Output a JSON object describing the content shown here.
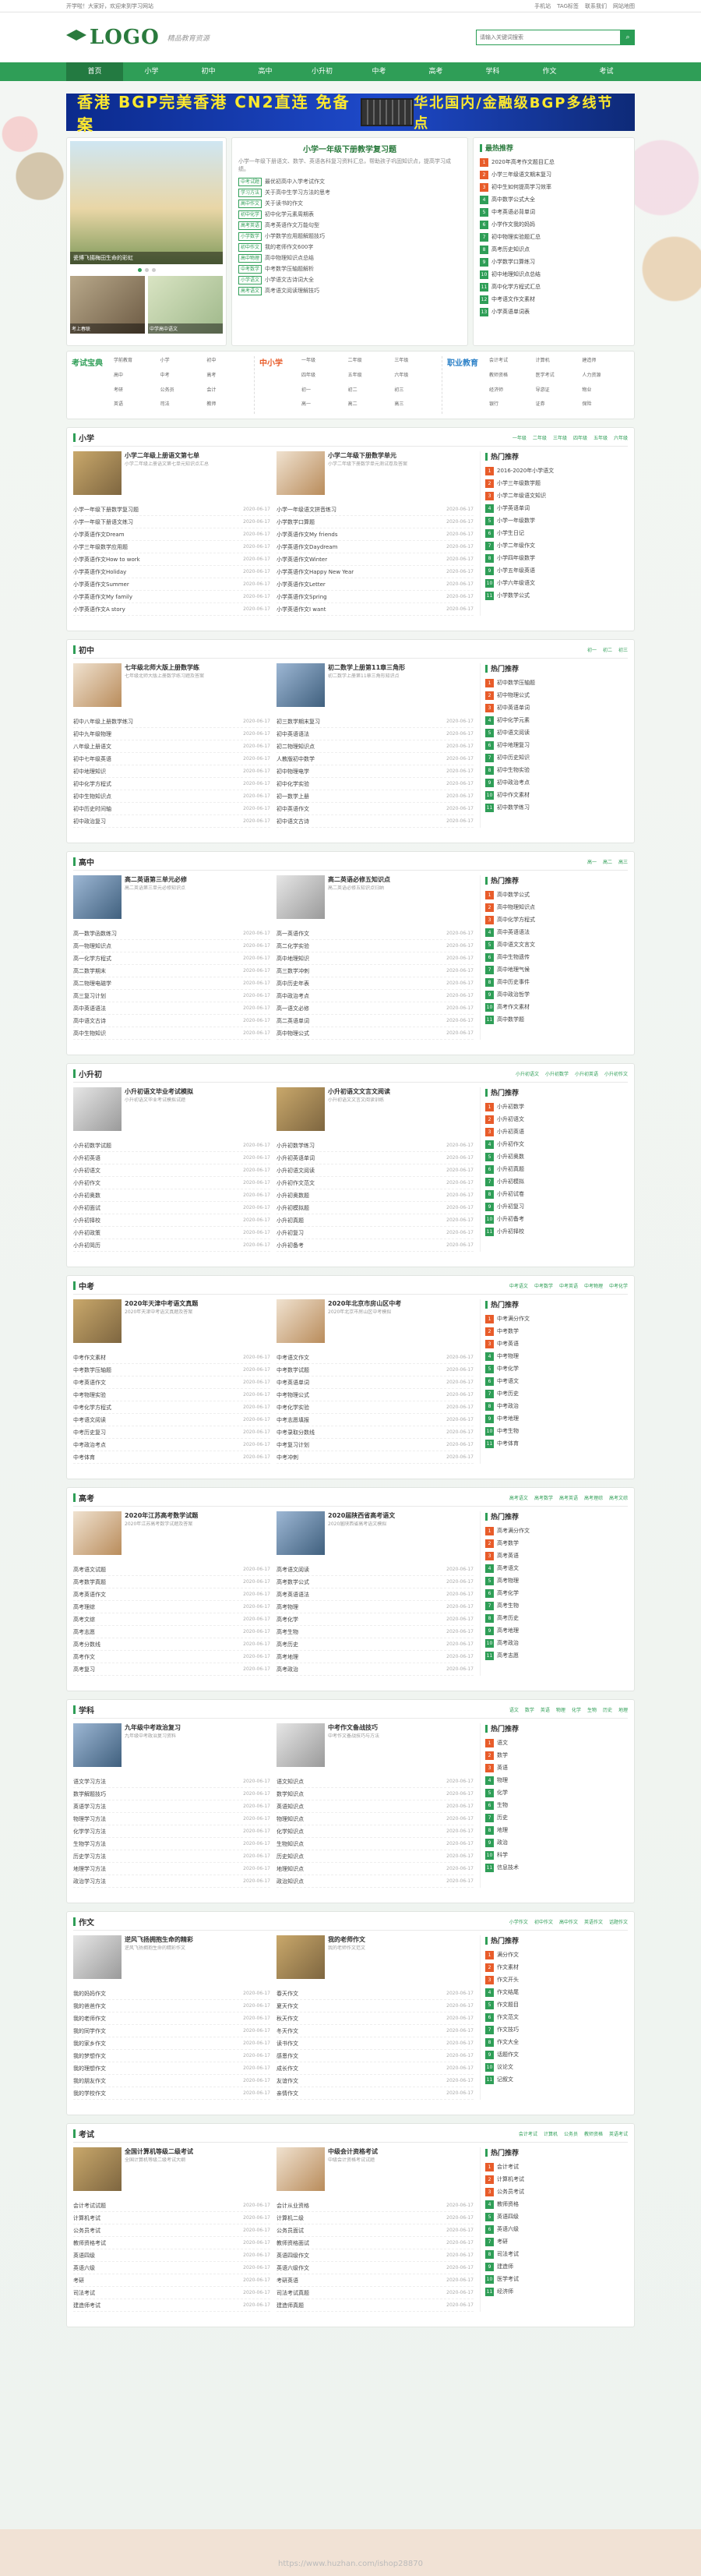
{
  "topbar": {
    "left": "开学啦！大家好，欢迎来到学习网站",
    "links": [
      "手机站",
      "TAG标签",
      "联系我们",
      "网站地图"
    ]
  },
  "header": {
    "logo": "LOGO",
    "slogan": "精品教育资源",
    "search_placeholder": "请输入关键词搜索",
    "search_icon": "search-icon"
  },
  "nav": [
    "首页",
    "小学",
    "初中",
    "高中",
    "小升初",
    "中考",
    "高考",
    "学科",
    "作文",
    "考试"
  ],
  "banner": {
    "left": "香港 BGP完美香港 CN2直连 免备案",
    "right": "华北国内/金融级BGP多线节点"
  },
  "hero": {
    "slide_caption": "瓷博飞揚梅田生命的彩虹",
    "thumbs": [
      "考上春联",
      "中学高中语文"
    ],
    "center_title": "小学一年级下册教学复习题",
    "center_desc": "小学一年级下册语文、数学、英语各科复习资料汇总，帮助孩子巩固知识点，提高学习成绩。",
    "items": [
      {
        "tag": "中考试题",
        "text": "最优初高中入学考试作文"
      },
      {
        "tag": "学习方法",
        "text": "关于高中生学习方法的思考"
      },
      {
        "tag": "高中作文",
        "text": "关于读书的作文"
      },
      {
        "tag": "初中化学",
        "text": "初中化学元素周期表"
      },
      {
        "tag": "高考英语",
        "text": "高考英语作文万能句型"
      },
      {
        "tag": "小学数学",
        "text": "小学数学应用题解题技巧"
      },
      {
        "tag": "初中作文",
        "text": "我的老师作文600字"
      },
      {
        "tag": "高中物理",
        "text": "高中物理知识点总结"
      },
      {
        "tag": "中考数学",
        "text": "中考数学压轴题解析"
      },
      {
        "tag": "小学语文",
        "text": "小学语文古诗词大全"
      },
      {
        "tag": "高考语文",
        "text": "高考语文阅读理解技巧"
      }
    ],
    "latest_title": "最热推荐",
    "latest": [
      "2020年高考作文题目汇总",
      "小学三年级语文期末复习",
      "初中生如何提高学习效率",
      "高中数学公式大全",
      "中考英语必背单词",
      "小学作文我的妈妈",
      "初中物理实验题汇总",
      "高考历史知识点",
      "小学数学口算练习",
      "初中地理知识点总结",
      "高中化学方程式汇总",
      "中考语文作文素材",
      "小学英语单词表"
    ]
  },
  "cats": [
    {
      "name": "考试宝典",
      "items": [
        "学前教育",
        "小学",
        "初中",
        "高中",
        "中考",
        "高考",
        "考研",
        "公务员",
        "会计",
        "英语",
        "司法",
        "教师"
      ]
    },
    {
      "name": "中小学",
      "items": [
        "一年级",
        "二年级",
        "三年级",
        "四年级",
        "五年级",
        "六年级",
        "初一",
        "初二",
        "初三",
        "高一",
        "高二",
        "高三"
      ]
    },
    {
      "name": "职业教育",
      "items": [
        "会计考试",
        "计算机",
        "建造师",
        "教师资格",
        "医学考试",
        "人力资源",
        "经济师",
        "导游证",
        "物业",
        "银行",
        "证券",
        "保险"
      ]
    }
  ],
  "panels": [
    {
      "title": "小学",
      "sub": [
        "一年级",
        "二年级",
        "三年级",
        "四年级",
        "五年级",
        "六年级"
      ],
      "feat": [
        {
          "h": "小学二年级上册语文第七单",
          "p": "小学二年级上册语文第七单元知识点汇总"
        },
        {
          "h": "小学二年级下册数学单元",
          "p": "小学二年级下册数学单元测试卷及答案"
        }
      ],
      "l1": [
        "小学一年级下册数学复习题",
        "小学一年级下册语文练习",
        "小学英语作文Dream",
        "小学三年级数学应用题",
        "小学英语作文How to work",
        "小学英语作文Holiday",
        "小学英语作文Summer",
        "小学英语作文My family",
        "小学英语作文A story"
      ],
      "l2": [
        "小学一年级语文拼音练习",
        "小学数学口算题",
        "小学英语作文My friends",
        "小学英语作文Daydream",
        "小学英语作文Winter",
        "小学英语作文Happy New Year",
        "小学英语作文Letter",
        "小学英语作文Spring",
        "小学英语作文I want"
      ],
      "hot": [
        "2016-2020年小学语文",
        "小学三年级数学题",
        "小学二年级语文知识",
        "小学英语单词",
        "小学一年级数学",
        "小学生日记",
        "小学二年级作文",
        "小学四年级数学",
        "小学五年级英语",
        "小学六年级语文",
        "小学数学公式"
      ]
    },
    {
      "title": "初中",
      "sub": [
        "初一",
        "初二",
        "初三"
      ],
      "feat": [
        {
          "h": "七年级北师大版上册数学练",
          "p": "七年级北师大版上册数学练习题及答案"
        },
        {
          "h": "初二数学上册第11章三角形",
          "p": "初二数学上册第11章三角形知识点"
        }
      ],
      "l1": [
        "初中八年级上册数学练习",
        "初中九年级物理",
        "八年级上册语文",
        "初中七年级英语",
        "初中地理知识",
        "初中化学方程式",
        "初中生物知识点",
        "初中历史时间轴",
        "初中政治复习"
      ],
      "l2": [
        "初三数学期末复习",
        "初中英语语法",
        "初二物理知识点",
        "人教版初中数学",
        "初中物理电学",
        "初中化学实验",
        "初一数学上册",
        "初中英语作文",
        "初中语文古诗"
      ],
      "hot": [
        "初中数学压轴题",
        "初中物理公式",
        "初中英语单词",
        "初中化学元素",
        "初中语文阅读",
        "初中地理复习",
        "初中历史知识",
        "初中生物实验",
        "初中政治考点",
        "初中作文素材",
        "初中数学练习"
      ]
    },
    {
      "title": "高中",
      "sub": [
        "高一",
        "高二",
        "高三"
      ],
      "feat": [
        {
          "h": "高二英语第三单元必修",
          "p": "高二英语第三单元必修知识点"
        },
        {
          "h": "高二英语必修五知识点",
          "p": "高二英语必修五知识点归纳"
        }
      ],
      "l1": [
        "高一数学函数练习",
        "高一物理知识点",
        "高一化学方程式",
        "高二数学期末",
        "高二物理电磁学",
        "高三复习计划",
        "高中英语语法",
        "高中语文古诗",
        "高中生物知识"
      ],
      "l2": [
        "高一英语作文",
        "高二化学实验",
        "高中地理知识",
        "高三数学冲刺",
        "高中历史年表",
        "高中政治考点",
        "高一语文必修",
        "高二英语单词",
        "高中物理公式"
      ],
      "hot": [
        "高中数学公式",
        "高中物理知识点",
        "高中化学方程式",
        "高中英语语法",
        "高中语文文言文",
        "高中生物遗传",
        "高中地理气候",
        "高中历史事件",
        "高中政治哲学",
        "高考作文素材",
        "高中数学题"
      ]
    },
    {
      "title": "小升初",
      "sub": [
        "小升初语文",
        "小升初数学",
        "小升初英语",
        "小升初作文"
      ],
      "feat": [
        {
          "h": "小升初语文毕业考试模拟",
          "p": "小升初语文毕业考试模拟试题"
        },
        {
          "h": "小升初语文文言文阅读",
          "p": "小升初语文文言文阅读训练"
        }
      ],
      "l1": [
        "小升初数学试题",
        "小升初英语",
        "小升初语文",
        "小升初作文",
        "小升初奥数",
        "小升初面试",
        "小升初择校",
        "小升初政策",
        "小升初简历"
      ],
      "l2": [
        "小升初数学练习",
        "小升初英语单词",
        "小升初语文阅读",
        "小升初作文范文",
        "小升初奥数题",
        "小升初模拟题",
        "小升初真题",
        "小升初复习",
        "小升初备考"
      ],
      "hot": [
        "小升初数学",
        "小升初语文",
        "小升初英语",
        "小升初作文",
        "小升初奥数",
        "小升初真题",
        "小升初模拟",
        "小升初试卷",
        "小升初复习",
        "小升初备考",
        "小升初择校"
      ]
    },
    {
      "title": "中考",
      "sub": [
        "中考语文",
        "中考数学",
        "中考英语",
        "中考物理",
        "中考化学"
      ],
      "feat": [
        {
          "h": "2020年天津中考语文真题",
          "p": "2020年天津中考语文真题及答案"
        },
        {
          "h": "2020年北京市房山区中考",
          "p": "2020年北京市房山区中考模拟"
        }
      ],
      "l1": [
        "中考作文素材",
        "中考数学压轴题",
        "中考英语作文",
        "中考物理实验",
        "中考化学方程式",
        "中考语文阅读",
        "中考历史复习",
        "中考政治考点",
        "中考体育"
      ],
      "l2": [
        "中考语文作文",
        "中考数学试题",
        "中考英语单词",
        "中考物理公式",
        "中考化学实验",
        "中考志愿填报",
        "中考录取分数线",
        "中考复习计划",
        "中考冲刺"
      ],
      "hot": [
        "中考满分作文",
        "中考数学",
        "中考英语",
        "中考物理",
        "中考化学",
        "中考语文",
        "中考历史",
        "中考政治",
        "中考地理",
        "中考生物",
        "中考体育"
      ]
    },
    {
      "title": "高考",
      "sub": [
        "高考语文",
        "高考数学",
        "高考英语",
        "高考理综",
        "高考文综"
      ],
      "feat": [
        {
          "h": "2020年江苏高考数学试题",
          "p": "2020年江苏高考数学试题及答案"
        },
        {
          "h": "2020届陕西省高考语文",
          "p": "2020届陕西省高考语文模拟"
        }
      ],
      "l1": [
        "高考语文试题",
        "高考数学真题",
        "高考英语作文",
        "高考理综",
        "高考文综",
        "高考志愿",
        "高考分数线",
        "高考作文",
        "高考复习"
      ],
      "l2": [
        "高考语文阅读",
        "高考数学公式",
        "高考英语语法",
        "高考物理",
        "高考化学",
        "高考生物",
        "高考历史",
        "高考地理",
        "高考政治"
      ],
      "hot": [
        "高考满分作文",
        "高考数学",
        "高考英语",
        "高考语文",
        "高考物理",
        "高考化学",
        "高考生物",
        "高考历史",
        "高考地理",
        "高考政治",
        "高考志愿"
      ]
    },
    {
      "title": "学科",
      "sub": [
        "语文",
        "数学",
        "英语",
        "物理",
        "化学",
        "生物",
        "历史",
        "地理"
      ],
      "feat": [
        {
          "h": "九年级中考政治复习",
          "p": "九年级中考政治复习资料"
        },
        {
          "h": "中考作文备战技巧",
          "p": "中考作文备战技巧与方法"
        }
      ],
      "l1": [
        "语文学习方法",
        "数学解题技巧",
        "英语学习方法",
        "物理学习方法",
        "化学学习方法",
        "生物学习方法",
        "历史学习方法",
        "地理学习方法",
        "政治学习方法"
      ],
      "l2": [
        "语文知识点",
        "数学知识点",
        "英语知识点",
        "物理知识点",
        "化学知识点",
        "生物知识点",
        "历史知识点",
        "地理知识点",
        "政治知识点"
      ],
      "hot": [
        "语文",
        "数学",
        "英语",
        "物理",
        "化学",
        "生物",
        "历史",
        "地理",
        "政治",
        "科学",
        "信息技术"
      ]
    },
    {
      "title": "作文",
      "sub": [
        "小学作文",
        "初中作文",
        "高中作文",
        "英语作文",
        "话题作文"
      ],
      "feat": [
        {
          "h": "逆风飞扬拥抱生命的精彩",
          "p": "逆风飞扬拥抱生命的精彩作文"
        },
        {
          "h": "我的老师作文",
          "p": "我的老师作文范文"
        }
      ],
      "l1": [
        "我的妈妈作文",
        "我的爸爸作文",
        "我的老师作文",
        "我的同学作文",
        "我的家乡作文",
        "我的梦想作文",
        "我的理想作文",
        "我的朋友作文",
        "我的学校作文"
      ],
      "l2": [
        "春天作文",
        "夏天作文",
        "秋天作文",
        "冬天作文",
        "读书作文",
        "感恩作文",
        "成长作文",
        "友谊作文",
        "亲情作文"
      ],
      "hot": [
        "满分作文",
        "作文素材",
        "作文开头",
        "作文结尾",
        "作文题目",
        "作文范文",
        "作文技巧",
        "作文大全",
        "话题作文",
        "议论文",
        "记叙文"
      ]
    },
    {
      "title": "考试",
      "sub": [
        "会计考试",
        "计算机",
        "公务员",
        "教师资格",
        "英语考试"
      ],
      "feat": [
        {
          "h": "全国计算机等级二级考试",
          "p": "全国计算机等级二级考试大纲"
        },
        {
          "h": "中级会计资格考试",
          "p": "中级会计资格考试试题"
        }
      ],
      "l1": [
        "会计考试试题",
        "计算机考试",
        "公务员考试",
        "教师资格考试",
        "英语四级",
        "英语六级",
        "考研",
        "司法考试",
        "建造师考试"
      ],
      "l2": [
        "会计从业资格",
        "计算机二级",
        "公务员面试",
        "教师资格面试",
        "英语四级作文",
        "英语六级作文",
        "考研英语",
        "司法考试真题",
        "建造师真题"
      ],
      "hot": [
        "会计考试",
        "计算机考试",
        "公务员考试",
        "教师资格",
        "英语四级",
        "英语六级",
        "考研",
        "司法考试",
        "建造师",
        "医学考试",
        "经济师"
      ]
    }
  ],
  "date": "2020-06-17",
  "watermark": "https://www.huzhan.com/ishop28870"
}
